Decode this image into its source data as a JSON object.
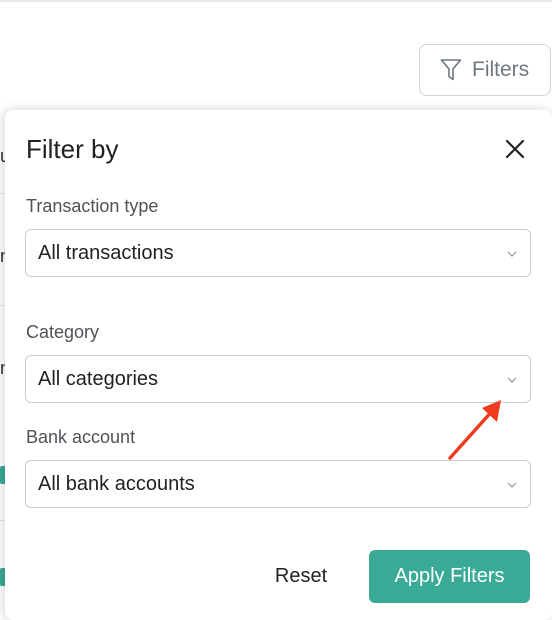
{
  "filters_button": {
    "label": "Filters",
    "icon": "funnel-icon"
  },
  "panel": {
    "title": "Filter by",
    "close_icon": "close-icon",
    "fields": [
      {
        "label": "Transaction type",
        "value": "All transactions"
      },
      {
        "label": "Category",
        "value": "All categories"
      },
      {
        "label": "Bank account",
        "value": "All bank accounts"
      }
    ],
    "reset_label": "Reset",
    "apply_label": "Apply Filters"
  },
  "colors": {
    "accent": "#3aa996",
    "annotation_arrow": "#ee3a1e",
    "border": "#c9cdd1"
  }
}
